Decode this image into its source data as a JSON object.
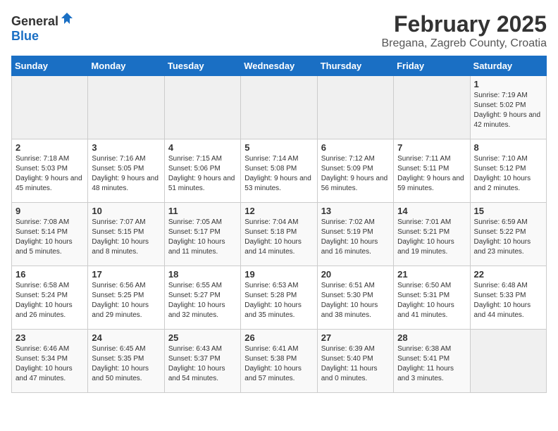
{
  "header": {
    "logo_general": "General",
    "logo_blue": "Blue",
    "month_year": "February 2025",
    "location": "Bregana, Zagreb County, Croatia"
  },
  "days_of_week": [
    "Sunday",
    "Monday",
    "Tuesday",
    "Wednesday",
    "Thursday",
    "Friday",
    "Saturday"
  ],
  "weeks": [
    [
      {
        "day": "",
        "info": ""
      },
      {
        "day": "",
        "info": ""
      },
      {
        "day": "",
        "info": ""
      },
      {
        "day": "",
        "info": ""
      },
      {
        "day": "",
        "info": ""
      },
      {
        "day": "",
        "info": ""
      },
      {
        "day": "1",
        "info": "Sunrise: 7:19 AM\nSunset: 5:02 PM\nDaylight: 9 hours and 42 minutes."
      }
    ],
    [
      {
        "day": "2",
        "info": "Sunrise: 7:18 AM\nSunset: 5:03 PM\nDaylight: 9 hours and 45 minutes."
      },
      {
        "day": "3",
        "info": "Sunrise: 7:16 AM\nSunset: 5:05 PM\nDaylight: 9 hours and 48 minutes."
      },
      {
        "day": "4",
        "info": "Sunrise: 7:15 AM\nSunset: 5:06 PM\nDaylight: 9 hours and 51 minutes."
      },
      {
        "day": "5",
        "info": "Sunrise: 7:14 AM\nSunset: 5:08 PM\nDaylight: 9 hours and 53 minutes."
      },
      {
        "day": "6",
        "info": "Sunrise: 7:12 AM\nSunset: 5:09 PM\nDaylight: 9 hours and 56 minutes."
      },
      {
        "day": "7",
        "info": "Sunrise: 7:11 AM\nSunset: 5:11 PM\nDaylight: 9 hours and 59 minutes."
      },
      {
        "day": "8",
        "info": "Sunrise: 7:10 AM\nSunset: 5:12 PM\nDaylight: 10 hours and 2 minutes."
      }
    ],
    [
      {
        "day": "9",
        "info": "Sunrise: 7:08 AM\nSunset: 5:14 PM\nDaylight: 10 hours and 5 minutes."
      },
      {
        "day": "10",
        "info": "Sunrise: 7:07 AM\nSunset: 5:15 PM\nDaylight: 10 hours and 8 minutes."
      },
      {
        "day": "11",
        "info": "Sunrise: 7:05 AM\nSunset: 5:17 PM\nDaylight: 10 hours and 11 minutes."
      },
      {
        "day": "12",
        "info": "Sunrise: 7:04 AM\nSunset: 5:18 PM\nDaylight: 10 hours and 14 minutes."
      },
      {
        "day": "13",
        "info": "Sunrise: 7:02 AM\nSunset: 5:19 PM\nDaylight: 10 hours and 16 minutes."
      },
      {
        "day": "14",
        "info": "Sunrise: 7:01 AM\nSunset: 5:21 PM\nDaylight: 10 hours and 19 minutes."
      },
      {
        "day": "15",
        "info": "Sunrise: 6:59 AM\nSunset: 5:22 PM\nDaylight: 10 hours and 23 minutes."
      }
    ],
    [
      {
        "day": "16",
        "info": "Sunrise: 6:58 AM\nSunset: 5:24 PM\nDaylight: 10 hours and 26 minutes."
      },
      {
        "day": "17",
        "info": "Sunrise: 6:56 AM\nSunset: 5:25 PM\nDaylight: 10 hours and 29 minutes."
      },
      {
        "day": "18",
        "info": "Sunrise: 6:55 AM\nSunset: 5:27 PM\nDaylight: 10 hours and 32 minutes."
      },
      {
        "day": "19",
        "info": "Sunrise: 6:53 AM\nSunset: 5:28 PM\nDaylight: 10 hours and 35 minutes."
      },
      {
        "day": "20",
        "info": "Sunrise: 6:51 AM\nSunset: 5:30 PM\nDaylight: 10 hours and 38 minutes."
      },
      {
        "day": "21",
        "info": "Sunrise: 6:50 AM\nSunset: 5:31 PM\nDaylight: 10 hours and 41 minutes."
      },
      {
        "day": "22",
        "info": "Sunrise: 6:48 AM\nSunset: 5:33 PM\nDaylight: 10 hours and 44 minutes."
      }
    ],
    [
      {
        "day": "23",
        "info": "Sunrise: 6:46 AM\nSunset: 5:34 PM\nDaylight: 10 hours and 47 minutes."
      },
      {
        "day": "24",
        "info": "Sunrise: 6:45 AM\nSunset: 5:35 PM\nDaylight: 10 hours and 50 minutes."
      },
      {
        "day": "25",
        "info": "Sunrise: 6:43 AM\nSunset: 5:37 PM\nDaylight: 10 hours and 54 minutes."
      },
      {
        "day": "26",
        "info": "Sunrise: 6:41 AM\nSunset: 5:38 PM\nDaylight: 10 hours and 57 minutes."
      },
      {
        "day": "27",
        "info": "Sunrise: 6:39 AM\nSunset: 5:40 PM\nDaylight: 11 hours and 0 minutes."
      },
      {
        "day": "28",
        "info": "Sunrise: 6:38 AM\nSunset: 5:41 PM\nDaylight: 11 hours and 3 minutes."
      },
      {
        "day": "",
        "info": ""
      }
    ]
  ]
}
